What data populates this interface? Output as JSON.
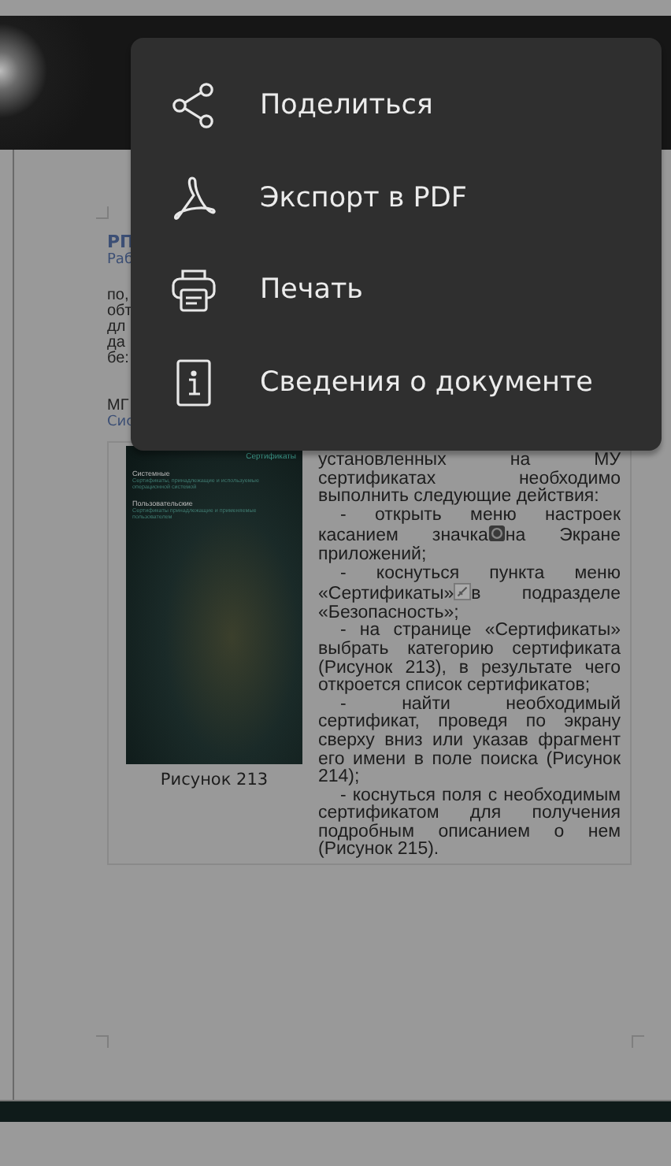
{
  "menu": {
    "items": [
      {
        "kind": "share",
        "label": "Поделиться"
      },
      {
        "kind": "pdf",
        "label": "Экспорт в PDF"
      },
      {
        "kind": "print",
        "label": "Печать"
      },
      {
        "kind": "info",
        "label": "Сведения о документе"
      }
    ]
  },
  "document": {
    "heading": "РП",
    "subheading": "Раб",
    "fragments": [
      "по,",
      "обт",
      "дл",
      "да",
      "бе:"
    ],
    "section": "МГ",
    "section_link": "Сис",
    "figure": {
      "screenshot": {
        "title": "Сертификаты",
        "groups": [
          {
            "name": "Системные",
            "description": "Сертификаты, принадлежащие и используемые операционной системой"
          },
          {
            "name": "Пользовательские",
            "description": "Сертификаты принадлежащие и применяемые пользователем"
          }
        ]
      },
      "caption": "Рисунок 213"
    },
    "paragraphs": [
      {
        "indent": false,
        "segments": [
          {
            "kind": "text",
            "text": "установленных на МУ сертификатах необходимо выполнить следующие действия:"
          }
        ]
      },
      {
        "indent": true,
        "segments": [
          {
            "kind": "text",
            "text": "- открыть меню настроек касанием значка"
          },
          {
            "kind": "appicon"
          },
          {
            "kind": "text",
            "text": "на Экране приложений;"
          }
        ]
      },
      {
        "indent": true,
        "segments": [
          {
            "kind": "text",
            "text": "- коснуться пункта меню «Сертификаты»"
          },
          {
            "kind": "certicon"
          },
          {
            "kind": "text",
            "text": "в подразделе «Безопасность»;"
          }
        ]
      },
      {
        "indent": true,
        "segments": [
          {
            "kind": "text",
            "text": "- на странице «Сертификаты» выбрать категорию сертификата (Рисунок 213), в результате чего откроется список сертификатов;"
          }
        ]
      },
      {
        "indent": true,
        "segments": [
          {
            "kind": "text",
            "text": "- найти необходимый сертификат, проведя по экрану сверху вниз или указав фрагмент его имени в поле поиска (Рисунок 214);"
          }
        ]
      },
      {
        "indent": true,
        "segments": [
          {
            "kind": "text",
            "text": "- коснуться поля с необходимым сертификатом для получения подробным описанием о нем (Рисунок 215)."
          }
        ]
      }
    ]
  }
}
